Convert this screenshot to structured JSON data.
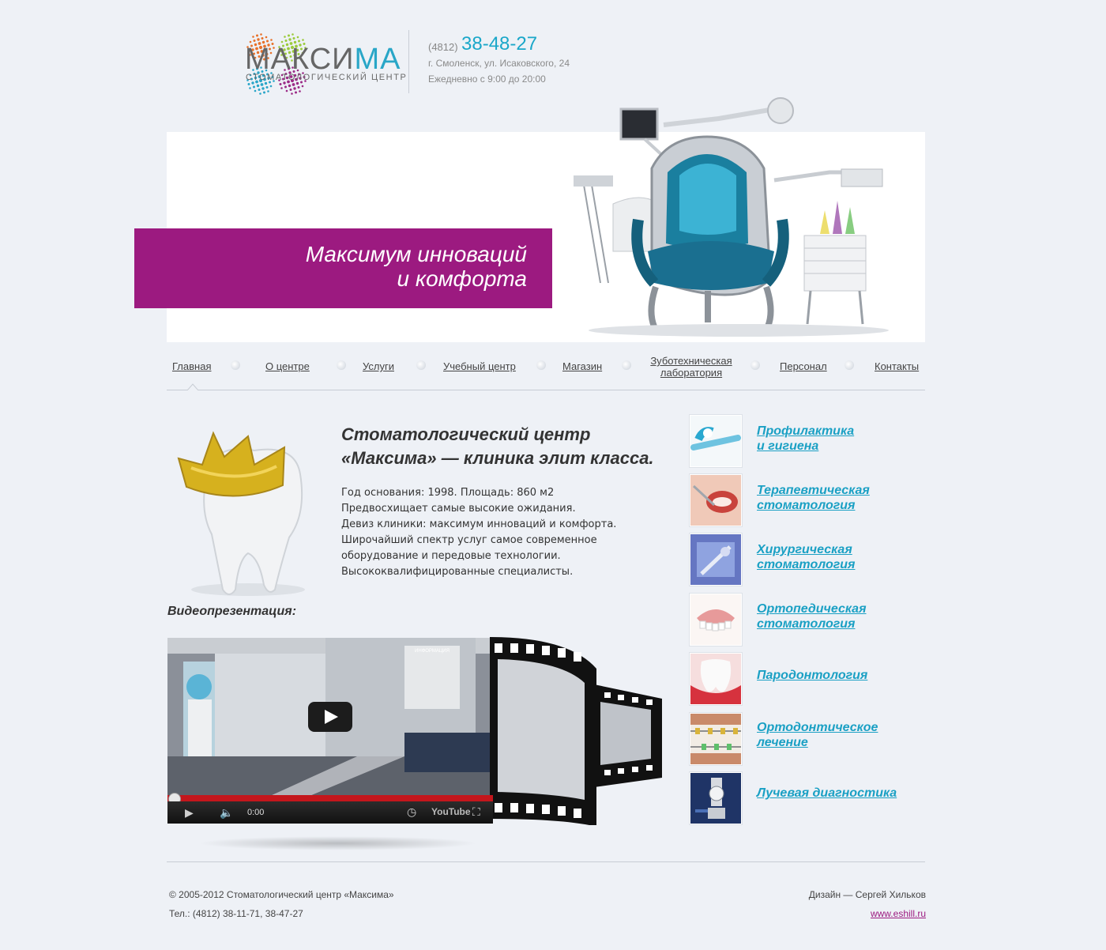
{
  "header": {
    "logo_word_main": "МАКСИ",
    "logo_word_accent": "МА",
    "logo_subtitle": "СТОМАТОЛОГИЧЕСКИЙ ЦЕНТР",
    "phone_code": "(4812)",
    "phone_number": "38-48-27",
    "address": "г. Смоленск, ул. Исаковского, 24",
    "hours": "Ежедневно с 9:00 до 20:00"
  },
  "banner": {
    "slogan_line1": "Максимум инноваций",
    "slogan_line2": "и комфорта"
  },
  "nav": {
    "items": [
      {
        "label": "Главная"
      },
      {
        "label": "О центре"
      },
      {
        "label": "Услуги"
      },
      {
        "label": "Учебный центр"
      },
      {
        "label": "Магазин"
      },
      {
        "label": "Зуботехническая"
      },
      {
        "label": "лаборатория"
      },
      {
        "label": "Персонал"
      },
      {
        "label": "Контакты"
      }
    ]
  },
  "content": {
    "title_line1": "Стоматологический центр",
    "title_line2": "«Максима» — клиника элит класса.",
    "desc_lines": [
      "Год основания: 1998. Площадь: 860 м2",
      "Предвосхищает самые высокие ожидания.",
      "Девиз клиники: максимум инноваций и комфорта.",
      "Широчайший спектр услуг самое современное",
      "оборудование и передовые технологии.",
      "Высококвалифицированные специалисты."
    ],
    "video_title": "Видеопрезентация:",
    "video_sign": "ИНФОРМАЦИЯ",
    "video_time": "0:00",
    "video_brand": "YouTube"
  },
  "services": [
    {
      "line1": "Профилактика",
      "line2": "и гигиена",
      "color": "#8fd0e6"
    },
    {
      "line1": "Терапевтическая",
      "line2": "стоматология",
      "color": "#e07a6a"
    },
    {
      "line1": "Хирургическая",
      "line2": "стоматология",
      "color": "#4d5fae"
    },
    {
      "line1": "Ортопедическая",
      "line2": "стоматология",
      "color": "#e6a0a0"
    },
    {
      "line1": "Пародонтология",
      "line2": "",
      "color": "#d8545a"
    },
    {
      "line1": "Ортодонтическое",
      "line2": "лечение",
      "color": "#c9a27b"
    },
    {
      "line1": "Лучевая диагностика",
      "line2": "",
      "color": "#243c78"
    }
  ],
  "footer": {
    "copyright": "© 2005-2012 Стоматологический центр «Максима»",
    "phones": "Тел.: (4812) 38-11-71, 38-47-27",
    "design": "Дизайн — Сергей Хильков",
    "design_link": "www.eshill.ru"
  },
  "colors": {
    "accent_blue": "#1aa7c9",
    "accent_purple": "#9c1a80",
    "background": "#eef1f6"
  }
}
